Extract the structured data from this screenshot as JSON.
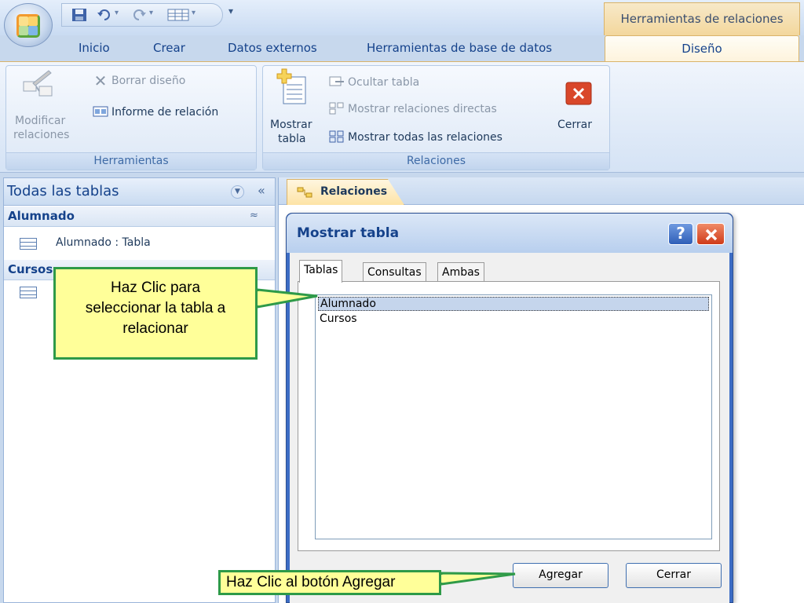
{
  "context_tab": {
    "title": "Herramientas de relaciones"
  },
  "tabs": [
    {
      "label": "Inicio"
    },
    {
      "label": "Crear"
    },
    {
      "label": "Datos externos"
    },
    {
      "label": "Herramientas de base de datos"
    },
    {
      "label": "Diseño",
      "active": true
    }
  ],
  "ribbon": {
    "herramientas": {
      "label": "Herramientas",
      "modificar_line1": "Modificar",
      "modificar_line2": "relaciones",
      "borrar": "Borrar diseño",
      "informe": "Informe de relación"
    },
    "relaciones": {
      "label": "Relaciones",
      "mostrar_line1": "Mostrar",
      "mostrar_line2": "tabla",
      "ocultar": "Ocultar tabla",
      "directas": "Mostrar relaciones directas",
      "todas": "Mostrar todas las relaciones",
      "cerrar": "Cerrar"
    }
  },
  "nav": {
    "title": "Todas las tablas",
    "groups": [
      {
        "title": "Alumnado",
        "item": "Alumnado : Tabla"
      },
      {
        "title": "Cursos"
      }
    ]
  },
  "doc": {
    "tab": "Relaciones"
  },
  "dialog": {
    "title": "Mostrar tabla",
    "help": "?",
    "tabs": [
      "Tablas",
      "Consultas",
      "Ambas"
    ],
    "items": [
      "Alumnado",
      "Cursos"
    ],
    "selected_index": 0,
    "agregar": "Agregar",
    "cerrar": "Cerrar"
  },
  "callouts": {
    "select_table": [
      "Haz Clic para",
      "seleccionar la tabla a",
      "relacionar"
    ],
    "add_button": "Haz Clic al botón Agregar"
  },
  "colors": {
    "accent": "#15428b",
    "context_tab": "#f3d79c",
    "callout_fill": "#ffff99",
    "callout_border": "#2e9a48"
  }
}
